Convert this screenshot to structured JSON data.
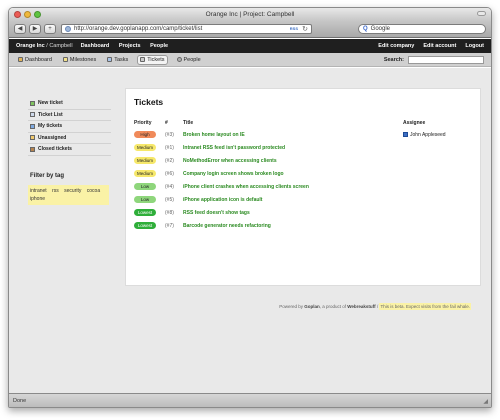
{
  "browser": {
    "window_title": "Orange Inc | Project: Campbell",
    "url": "http://orange.dev.goplanapp.com/camp/ticket/list",
    "search_engine": "Google",
    "status": "Done"
  },
  "app_header": {
    "brand": "Orange Inc",
    "separator": " / ",
    "project": "Campbell",
    "nav": [
      "Dashboard",
      "Projects",
      "People"
    ],
    "right": [
      "Edit company",
      "Edit account",
      "Logout"
    ]
  },
  "tabs": {
    "items": [
      {
        "label": "Dashboard",
        "icon": "house-icon"
      },
      {
        "label": "Milestones",
        "icon": "milestone-icon"
      },
      {
        "label": "Tasks",
        "icon": "tasks-icon"
      },
      {
        "label": "Tickets",
        "icon": "tickets-icon"
      },
      {
        "label": "People",
        "icon": "people-icon"
      }
    ],
    "active": "Tickets",
    "search_label": "Search:"
  },
  "sidebar": {
    "items": [
      {
        "label": "New ticket",
        "icon": "new-ticket-icon"
      },
      {
        "label": "Ticket List",
        "icon": "ticket-list-icon"
      },
      {
        "label": "My tickets",
        "icon": "my-tickets-icon"
      },
      {
        "label": "Unassigned",
        "icon": "unassigned-icon"
      },
      {
        "label": "Closed tickets",
        "icon": "closed-tickets-icon"
      }
    ],
    "filter_title": "Filter by tag",
    "tags": [
      "intranet",
      "rss",
      "security",
      "cocoa",
      "iphone"
    ]
  },
  "main": {
    "heading": "Tickets",
    "columns": [
      "Priority",
      "#",
      "Title",
      "Assignee"
    ],
    "rows": [
      {
        "priority": "High",
        "color": "#f08a5a",
        "num": "(#3)",
        "title": "Broken home layout on IE",
        "assignee": "John Appleseed"
      },
      {
        "priority": "Medium",
        "color": "#f6e86b",
        "num": "(#1)",
        "title": "Intranet RSS feed isn't password protected",
        "assignee": ""
      },
      {
        "priority": "Medium",
        "color": "#f6e86b",
        "num": "(#2)",
        "title": "NoMethodError when accessing clients",
        "assignee": ""
      },
      {
        "priority": "Medium",
        "color": "#f6e86b",
        "num": "(#6)",
        "title": "Company login screen shows broken logo",
        "assignee": ""
      },
      {
        "priority": "Low",
        "color": "#8fd67c",
        "num": "(#4)",
        "title": "iPhone client crashes when accessing clients screen",
        "assignee": ""
      },
      {
        "priority": "Low",
        "color": "#8fd67c",
        "num": "(#5)",
        "title": "iPhone application icon is default",
        "assignee": ""
      },
      {
        "priority": "Lowest",
        "color": "#2fae3a",
        "num": "(#8)",
        "title": "RSS feed doesn't show tags",
        "assignee": ""
      },
      {
        "priority": "Lowest",
        "color": "#2fae3a",
        "num": "(#7)",
        "title": "Barcode generator needs refactoring",
        "assignee": ""
      }
    ]
  },
  "footer": {
    "prefix": "Powered by ",
    "product": "Goplan",
    "middle": ", a product of ",
    "company": "Webreakstuff",
    "sep": " / ",
    "beta": "This is beta. Expect visits from the fail whale."
  }
}
